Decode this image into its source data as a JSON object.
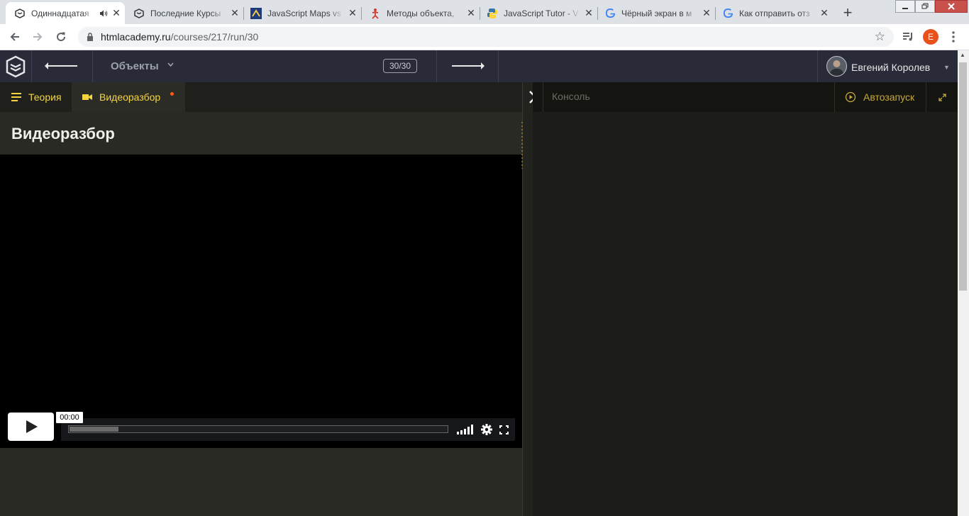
{
  "browser": {
    "tabs": [
      {
        "title": "Одиннадцатая",
        "favicon": "htmlacademy-icon",
        "active": true,
        "audio": true
      },
      {
        "title": "Последние Курсы",
        "favicon": "htmlacademy-icon"
      },
      {
        "title": "JavaScript Maps vs",
        "favicon": "code-icon"
      },
      {
        "title": "Методы объекта,",
        "favicon": "figure-icon"
      },
      {
        "title": "JavaScript Tutor - V",
        "favicon": "python-icon"
      },
      {
        "title": "Чёрный экран в м",
        "favicon": "google-icon"
      },
      {
        "title": "Как отправить отз",
        "favicon": "google-icon"
      }
    ],
    "new_tab_label": "+",
    "url_host": "htmlacademy.ru",
    "url_path": "/courses/217/run/30",
    "profile_initial": "E"
  },
  "header": {
    "section_title": "Объекты",
    "counter": "30/30",
    "user_name": "Евгений Королев"
  },
  "left_panel": {
    "tabs": [
      {
        "label": "Теория",
        "icon": "menu-icon"
      },
      {
        "label": "Видеоразбор",
        "icon": "video-camera-icon"
      }
    ],
    "title": "Видеоразбор",
    "player": {
      "time": "00:00",
      "buffered": 0.13
    }
  },
  "right_panel": {
    "console_label": "Консоль",
    "autorun_label": "Автозапуск"
  },
  "colors": {
    "accent": "#f5d442",
    "header_bg": "#292b38",
    "notification_dot": "#ff5b1f"
  }
}
